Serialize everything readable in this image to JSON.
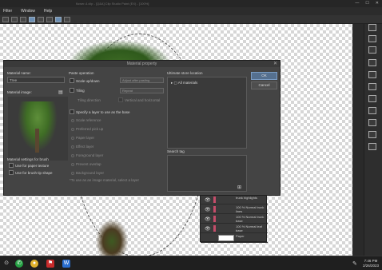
{
  "window": {
    "title": "flower-4.clip - [Q&A] Clip Studio Paint (EX) - [100%]",
    "controls": [
      "—",
      "☐",
      "✕"
    ]
  },
  "menu": [
    "Filter",
    "Window",
    "Help"
  ],
  "dialog": {
    "title": "Material property",
    "close": "✕",
    "material_name_label": "Material name:",
    "material_name_value": "Tree",
    "material_image_label": "Material image:",
    "settings_for_brush_label": "Material settings for brush",
    "use_paper_texture": "Use for paper texture",
    "use_brush_tip": "Use for brush tip shape",
    "paste_operation_label": "Paste operation",
    "scale_up_down": "Scale up/down",
    "scale_dropdown": "Adjust after pasting",
    "tiling": "Tiling",
    "tiling_dropdown": "Repeat",
    "tiling_direction": "Tiling direction",
    "vertical_horizontal": "Vertical and horizontal",
    "specify_layer": "Specify a layer to use as the base",
    "layer_options": [
      "Scale reference",
      "Preferred pick up",
      "Paper layer",
      "Effect layer",
      "Foreground layer",
      "Prevent overlap",
      "Background layer"
    ],
    "note": "*To use as an image material, select a layer",
    "storage_location_label": "Ultimate store location",
    "tree_item": "All materials",
    "search_tag_label": "Search tag",
    "ok": "OK",
    "cancel": "Cancel"
  },
  "layers": [
    {
      "name": "trunk highlights"
    },
    {
      "name": "100 % Normal trunk lines"
    },
    {
      "name": "100 % Normal trunk base"
    },
    {
      "name": "100 % Normal leaf base"
    },
    {
      "name": "Paper"
    }
  ],
  "taskbar": {
    "apps": [
      "start",
      "chat",
      "chrome",
      "sling",
      "word"
    ],
    "time": "7:46 PM",
    "date": "2/26/2023"
  }
}
